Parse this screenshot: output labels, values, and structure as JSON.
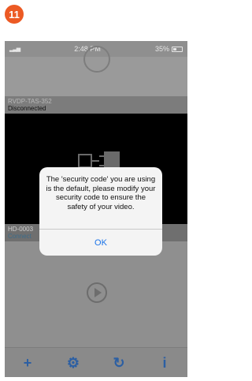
{
  "step_badge": "11",
  "status_bar": {
    "time": "2:48 PM",
    "battery_percent": "35%",
    "signal_icon": "signal-bars-icon"
  },
  "cameras": [
    {
      "name": "RVDP-TAS-352",
      "status": "Disconnected"
    },
    {
      "name": "HD-0003",
      "status": "Connect"
    }
  ],
  "dialog": {
    "message": "The 'security code' you are using is the default, please modify your security code to ensure the safety of your video.",
    "ok_label": "OK"
  },
  "tabbar": {
    "items": [
      {
        "icon": "plus-icon",
        "glyph": "+"
      },
      {
        "icon": "gear-icon",
        "glyph": "⚙"
      },
      {
        "icon": "refresh-icon",
        "glyph": "↻"
      },
      {
        "icon": "info-icon",
        "glyph": "i"
      }
    ]
  },
  "colors": {
    "badge": "#ec5a24",
    "tab_icons": "#2c5fa3",
    "ok_text": "#1a73e8"
  }
}
